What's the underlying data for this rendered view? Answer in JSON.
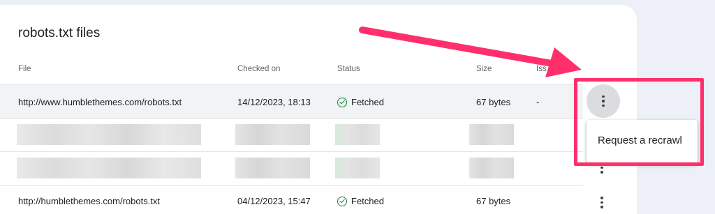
{
  "card": {
    "title": "robots.txt files"
  },
  "table": {
    "headers": [
      "File",
      "Checked on",
      "Status",
      "Size",
      "Iss"
    ],
    "rows": [
      {
        "file": "http://www.humblethemes.com/robots.txt",
        "checked_on": "14/12/2023, 18:13",
        "status": "Fetched",
        "size": "67 bytes",
        "issues": "-"
      },
      {
        "file": "http://humblethemes.com/robots.txt",
        "checked_on": "04/12/2023, 15:47",
        "status": "Fetched",
        "size": "67 bytes",
        "issues": ""
      }
    ]
  },
  "menu": {
    "items": [
      {
        "label": "Request a recrawl"
      }
    ]
  },
  "icons": {
    "more": "more-vert-icon",
    "status_ok": "check-circle-icon"
  },
  "colors": {
    "annotation": "#ff2f6c",
    "status_ok": "#188038",
    "row_highlight": "#f1f3f4"
  }
}
